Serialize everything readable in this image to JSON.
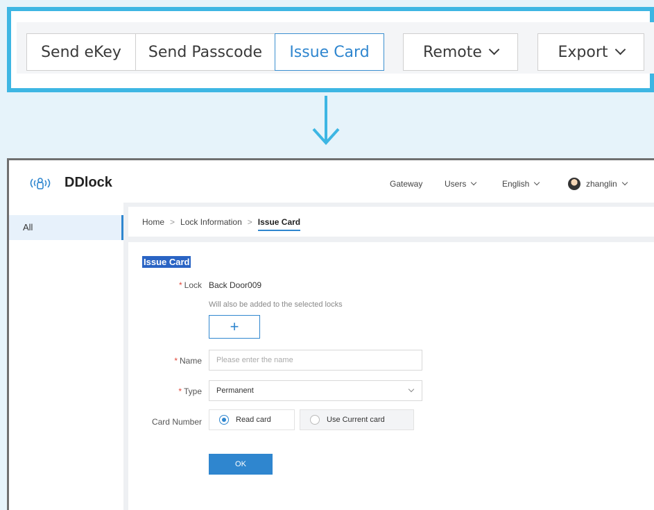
{
  "toolbar": {
    "send_ekey": "Send eKey",
    "send_passcode": "Send Passcode",
    "issue_card": "Issue Card",
    "remote": "Remote",
    "export": "Export"
  },
  "app": {
    "brand": "DDlock",
    "nav": {
      "gateway": "Gateway",
      "users": "Users",
      "language": "English",
      "username": "zhanglin"
    },
    "sidebar": {
      "items": [
        {
          "label": "All"
        }
      ]
    },
    "breadcrumb": {
      "home": "Home",
      "lock_info": "Lock Information",
      "current": "Issue Card",
      "separator": ">"
    },
    "form": {
      "title": "Issue Card",
      "lock_label": "Lock",
      "lock_value": "Back Door009",
      "lock_hint": "Will also be added to the selected locks",
      "add_symbol": "+",
      "name_label": "Name",
      "name_placeholder": "Please enter the name",
      "type_label": "Type",
      "type_value": "Permanent",
      "card_number_label": "Card Number",
      "option_read": "Read card",
      "option_current": "Use Current card",
      "required_mark": "*",
      "ok": "OK"
    }
  },
  "colors": {
    "highlight_frame": "#3db6e3",
    "accent": "#2f86cf",
    "required": "#e0473a"
  }
}
